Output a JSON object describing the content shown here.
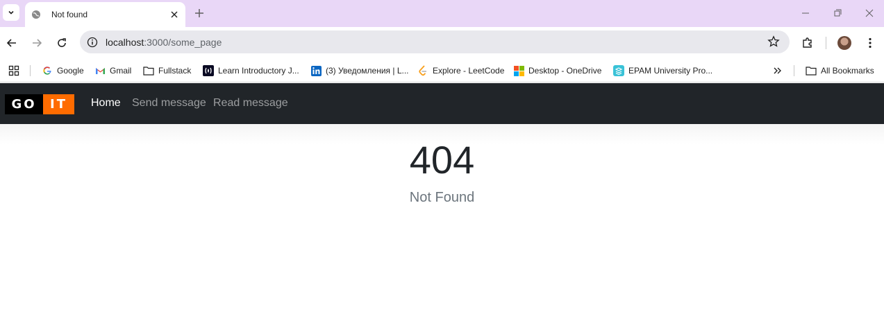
{
  "browser": {
    "tab": {
      "title": "Not found"
    },
    "address": {
      "host": "localhost",
      "path": ":3000/some_page"
    },
    "bookmarks": [
      {
        "label": "Google",
        "icon": "google-icon"
      },
      {
        "label": "Gmail",
        "icon": "gmail-icon"
      },
      {
        "label": "Fullstack",
        "icon": "folder-icon"
      },
      {
        "label": "Learn Introductory J...",
        "icon": "freecodecamp-icon"
      },
      {
        "label": "(3) Уведомления | L...",
        "icon": "linkedin-icon"
      },
      {
        "label": "Explore - LeetCode",
        "icon": "leetcode-icon"
      },
      {
        "label": "Desktop - OneDrive",
        "icon": "microsoft-icon"
      },
      {
        "label": "EPAM University Pro...",
        "icon": "epam-icon"
      }
    ],
    "all_bookmarks_label": "All Bookmarks"
  },
  "site": {
    "logo": {
      "left": "GO",
      "right": "IT"
    },
    "nav": [
      {
        "label": "Home",
        "active": true
      },
      {
        "label": "Send message",
        "active": false
      },
      {
        "label": "Read message",
        "active": false
      }
    ],
    "colors": {
      "navbar": "#212529",
      "logo_accent": "#ff6c00"
    }
  },
  "error": {
    "code": "404",
    "message": "Not Found"
  }
}
